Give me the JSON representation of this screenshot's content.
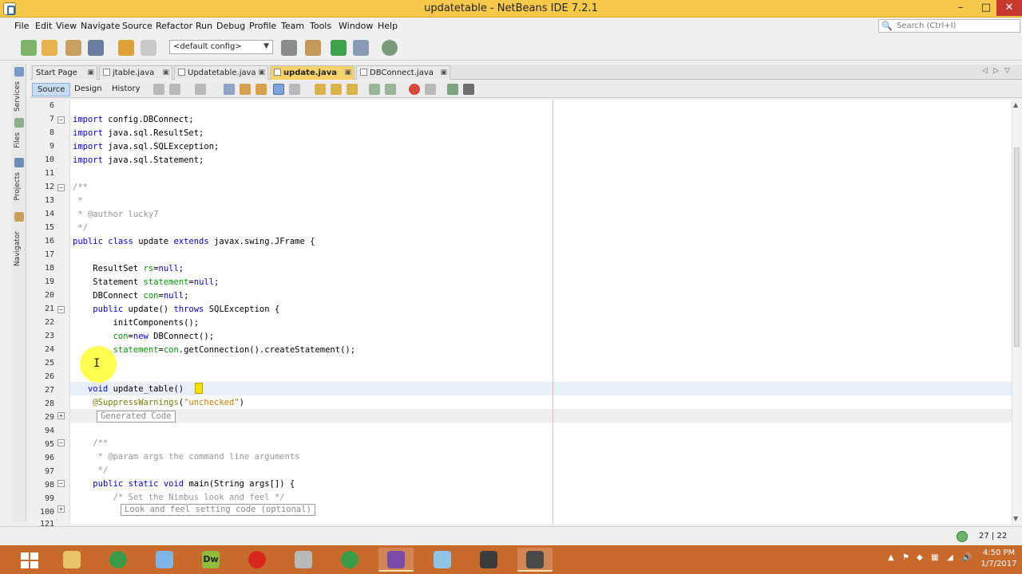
{
  "window": {
    "title": "updatetable - NetBeans IDE 7.2.1",
    "min": "–",
    "max": "□",
    "close": "✕"
  },
  "menu": [
    "File",
    "Edit",
    "View",
    "Navigate",
    "Source",
    "Refactor",
    "Run",
    "Debug",
    "Profile",
    "Team",
    "Tools",
    "Window",
    "Help"
  ],
  "search": {
    "placeholder": "Search (Ctrl+I)"
  },
  "toolbar": {
    "config": "<default config>"
  },
  "side_panels": [
    "Services",
    "Files",
    "Projects",
    "Navigator"
  ],
  "tabs": [
    {
      "label": "Start Page"
    },
    {
      "label": "jtable.java"
    },
    {
      "label": "Updatetable.java"
    },
    {
      "label": "update.java"
    },
    {
      "label": "DBConnect.java"
    }
  ],
  "editor_tabs": [
    "Source",
    "Design",
    "History"
  ],
  "code_lines": [
    {
      "n": "6",
      "t": ""
    },
    {
      "n": "7",
      "t": "import config.DBConnect;"
    },
    {
      "n": "8",
      "t": "import java.sql.ResultSet;"
    },
    {
      "n": "9",
      "t": "import java.sql.SQLException;"
    },
    {
      "n": "10",
      "t": "import java.sql.Statement;"
    },
    {
      "n": "11",
      "t": ""
    },
    {
      "n": "12",
      "t": "/**"
    },
    {
      "n": "13",
      "t": " *"
    },
    {
      "n": "14",
      "t": " * @author lucky7"
    },
    {
      "n": "15",
      "t": " */"
    },
    {
      "n": "16",
      "t": "public class update extends javax.swing.JFrame {"
    },
    {
      "n": "17",
      "t": ""
    },
    {
      "n": "18",
      "t": "    ResultSet rs=null;"
    },
    {
      "n": "19",
      "t": "    Statement statement=null;"
    },
    {
      "n": "20",
      "t": "    DBConnect con=null;"
    },
    {
      "n": "21",
      "t": "    public update() throws SQLException {"
    },
    {
      "n": "22",
      "t": "        initComponents();"
    },
    {
      "n": "23",
      "t": "        con=new DBConnect();"
    },
    {
      "n": "24",
      "t": "        statement=con.getConnection().createStatement();"
    },
    {
      "n": "25",
      "t": ""
    },
    {
      "n": "26",
      "t": ""
    },
    {
      "n": "27",
      "t": "   void update_table()"
    },
    {
      "n": "28",
      "t": "    @SuppressWarnings(\"unchecked\")"
    },
    {
      "n": "29",
      "t": "    Generated Code"
    },
    {
      "n": "94",
      "t": ""
    },
    {
      "n": "95",
      "t": "    /**"
    },
    {
      "n": "96",
      "t": "     * @param args the command line arguments"
    },
    {
      "n": "97",
      "t": "     */"
    },
    {
      "n": "98",
      "t": "    public static void main(String args[]) {"
    },
    {
      "n": "99",
      "t": "        /* Set the Nimbus look and feel */"
    },
    {
      "n": "100",
      "t": "        Look and feel setting code (optional)"
    },
    {
      "n": "121",
      "t": ""
    }
  ],
  "status": {
    "position": "27 | 22"
  },
  "clock": {
    "time": "4:50 PM",
    "date": "1/7/2017"
  },
  "colors": {
    "titlebar": "#f6c94a",
    "taskbar": "#c86a2c",
    "keyword": "#0000e6",
    "comment": "#969696",
    "field": "#009900",
    "string": "#ce7b00"
  }
}
